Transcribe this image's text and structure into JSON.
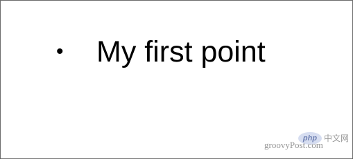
{
  "slide": {
    "bullet_glyph": "•",
    "bullet_text": "My first point"
  },
  "watermark": {
    "php_logo": "php",
    "site": "groovyPost.com",
    "cn_text": "中文网"
  }
}
